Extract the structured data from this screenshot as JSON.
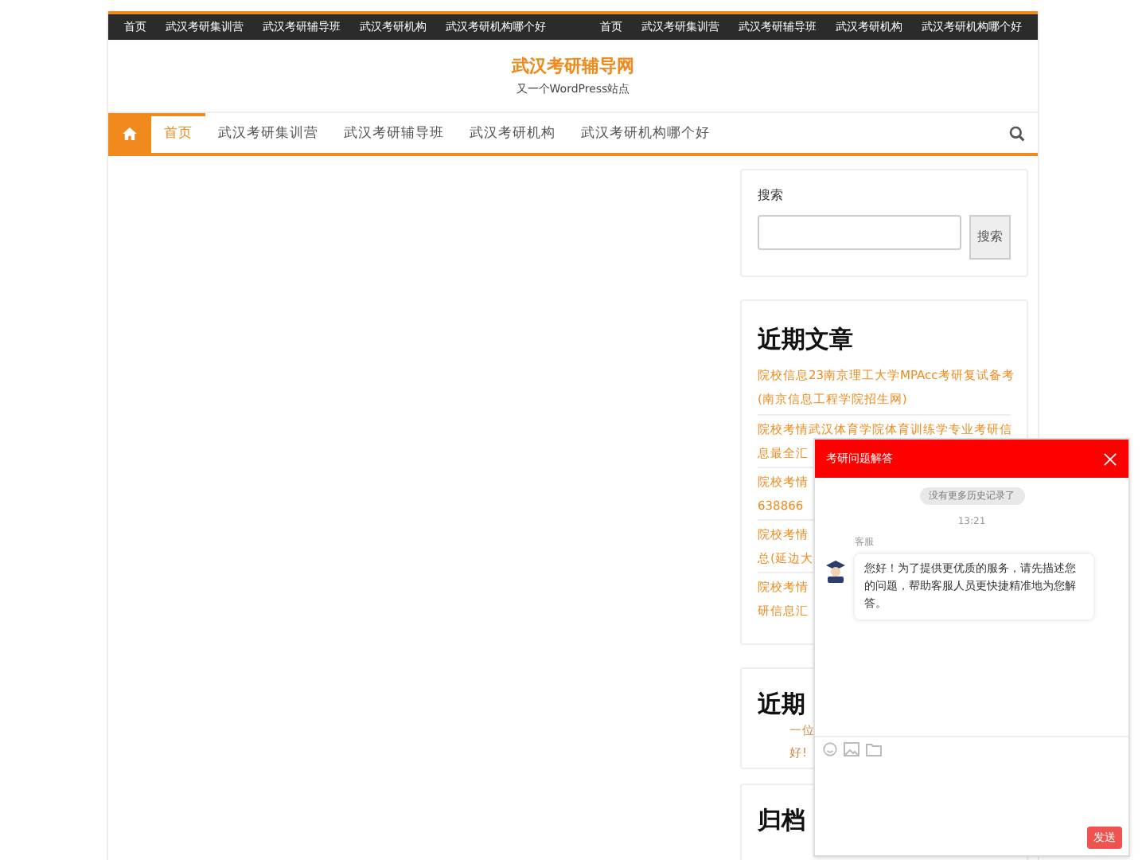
{
  "top_menu_left": [
    "首页",
    "武汉考研集训营",
    "武汉考研辅导班",
    "武汉考研机构",
    "武汉考研机构哪个好"
  ],
  "top_menu_right": [
    "首页",
    "武汉考研集训营",
    "武汉考研辅导班",
    "武汉考研机构",
    "武汉考研机构哪个好"
  ],
  "site": {
    "title": "武汉考研辅导网",
    "tagline": "又一个WordPress站点"
  },
  "nav": [
    {
      "label": "首页",
      "selected": true
    },
    {
      "label": "武汉考研集训营",
      "selected": false
    },
    {
      "label": "武汉考研辅导班",
      "selected": false
    },
    {
      "label": "武汉考研机构",
      "selected": false
    },
    {
      "label": "武汉考研机构哪个好",
      "selected": false
    }
  ],
  "search_widget": {
    "label": "搜索",
    "button": "搜索"
  },
  "recent_posts": {
    "title": "近期文章",
    "items": [
      {
        "lines": [
          "院校信息23南京理工大学MPAcc考研复试备考",
          "(南京信息工程学院招生网)"
        ]
      },
      {
        "lines": [
          "院校考情武汉体育学院体育训练学专业考研信",
          "息最全汇"
        ]
      },
      {
        "lines": [
          "院校考情",
          "638866"
        ]
      },
      {
        "lines": [
          "院校考情",
          "总(延边大"
        ]
      },
      {
        "lines": [
          "院校考情",
          "研信息汇"
        ]
      }
    ]
  },
  "recent_comments": {
    "title": "近期",
    "lines": [
      "一位",
      "好!"
    ]
  },
  "archive": {
    "title": "归档"
  },
  "chat": {
    "title": "考研问题解答",
    "history_note": "没有更多历史记录了",
    "time": "13:21",
    "agent": "客服",
    "message": "您好！为了提供更优质的服务，请先描述您的问题，帮助客服人员更快捷精准地为您解答。",
    "send": "发送"
  }
}
